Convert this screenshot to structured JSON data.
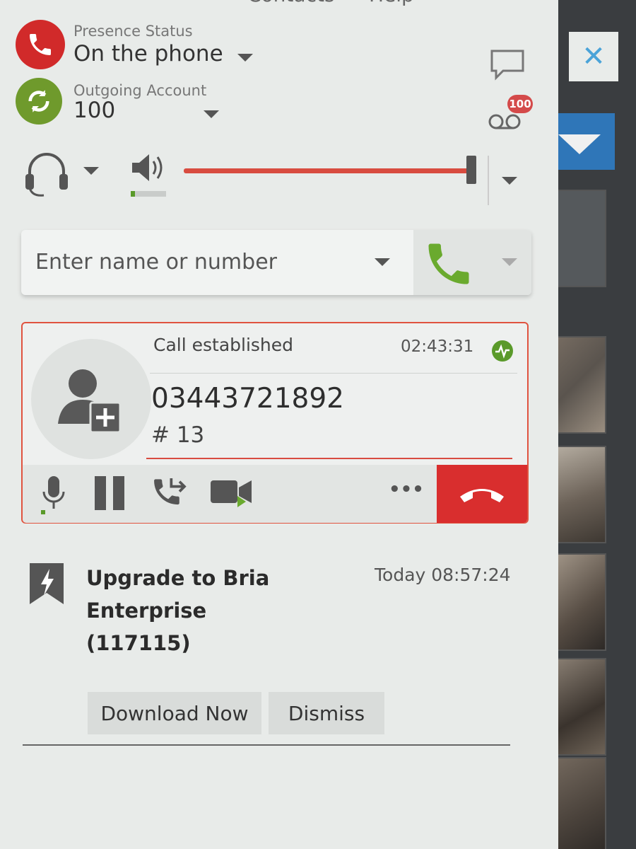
{
  "menu": {
    "item_contacts": "Contacts",
    "item_help": "Help"
  },
  "presence": {
    "label": "Presence Status",
    "value": "On the phone"
  },
  "account": {
    "label": "Outgoing Account",
    "value": "100"
  },
  "voicemail": {
    "badge": "100"
  },
  "audio": {
    "volume_level": 0.98
  },
  "dial": {
    "placeholder": "Enter name or number"
  },
  "call": {
    "status": "Call established",
    "timer": "02:43:31",
    "number": "03443721892",
    "dtmf": "# 13",
    "more_label": "•••"
  },
  "notification": {
    "title": "Upgrade to Bria Enterprise (117115)",
    "time": "Today 08:57:24",
    "download_label": "Download Now",
    "dismiss_label": "Dismiss"
  },
  "colors": {
    "accent_red": "#d92e2e",
    "presence_red": "#d12a2a",
    "account_green": "#6f9a2c",
    "call_green": "#6aaa2e"
  }
}
